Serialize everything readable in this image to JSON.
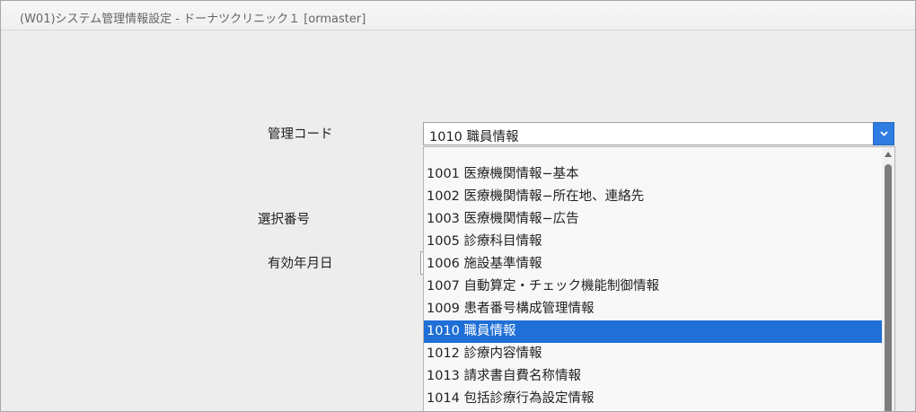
{
  "window": {
    "title": "(W01)システム管理情報設定 - ドーナツクリニック１ [ormaster]"
  },
  "form": {
    "kanri_code_label": "管理コード",
    "sentaku_bango_label": "選択番号",
    "yuko_nengappi_label": "有効年月日",
    "kanri_code_value": "1010 職員情報"
  },
  "dropdown": {
    "options": [
      {
        "label": "1001 医療機関情報−基本"
      },
      {
        "label": "1002 医療機関情報−所在地、連絡先"
      },
      {
        "label": "1003 医療機関情報−広告"
      },
      {
        "label": "1005 診療科目情報"
      },
      {
        "label": "1006 施設基準情報"
      },
      {
        "label": "1007 自動算定・チェック機能制御情報"
      },
      {
        "label": "1009 患者番号構成管理情報"
      },
      {
        "label": "1010 職員情報"
      },
      {
        "label": "1012 診療内容情報"
      },
      {
        "label": "1013 請求書自費名称情報"
      },
      {
        "label": "1014 包括診療行為設定情報"
      }
    ],
    "selected_index": 7
  },
  "icons": {
    "dropdown_arrow": "chevron-down-icon",
    "scroll_up": "triangle-up-icon"
  },
  "colors": {
    "accent": "#1f6fd6",
    "select_button": "#2f7de1",
    "background": "#ededed"
  }
}
